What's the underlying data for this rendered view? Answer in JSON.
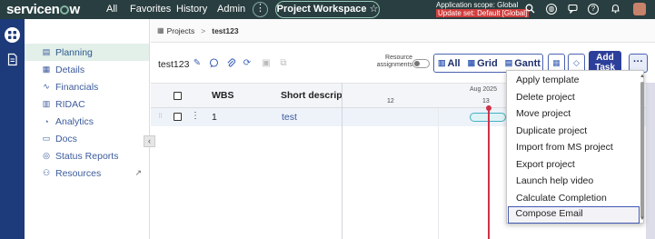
{
  "topnav": {
    "brand": "servicenow",
    "links": [
      "All",
      "Favorites",
      "History",
      "Admin"
    ],
    "more_label": "⋮",
    "workspace_label": "Project Workspace",
    "workspace_star": "☆",
    "scope_line": "Application scope: Global",
    "update_set": "Update set: Default [Global]",
    "icons": [
      "search-icon",
      "globe-icon",
      "chat-icon",
      "help-icon",
      "bell-icon"
    ]
  },
  "breadcrumb": {
    "root": "Projects",
    "separator": ">",
    "current": "test123"
  },
  "sidebar": {
    "items": [
      {
        "label": "Planning",
        "icon": "planning-icon",
        "glyph": "▤",
        "active": true
      },
      {
        "label": "Details",
        "icon": "details-icon",
        "glyph": "▦",
        "active": false
      },
      {
        "label": "Financials",
        "icon": "financials-icon",
        "glyph": "∿",
        "active": false
      },
      {
        "label": "RIDAC",
        "icon": "ridac-icon",
        "glyph": "▥",
        "active": false
      },
      {
        "label": "Analytics",
        "icon": "analytics-icon",
        "glyph": "◔",
        "active": false
      },
      {
        "label": "Docs",
        "icon": "docs-icon",
        "glyph": "▭",
        "active": false
      },
      {
        "label": "Status Reports",
        "icon": "status-reports-icon",
        "glyph": "◎",
        "active": false
      },
      {
        "label": "Resources",
        "icon": "resources-icon",
        "glyph": "⚇",
        "active": false
      }
    ],
    "collapse_glyph": "‹"
  },
  "toolbar": {
    "record_title": "test123",
    "resource_label": "Resource assignments",
    "views": [
      {
        "label": "All",
        "glyph": "▥",
        "selected": true
      },
      {
        "label": "Grid",
        "glyph": "▦",
        "selected": false
      },
      {
        "label": "Gantt",
        "glyph": "▤",
        "selected": false
      }
    ],
    "add_task_label": "Add Task",
    "more_label": "···"
  },
  "grid": {
    "columns": [
      "WBS",
      "Short description"
    ],
    "rows": [
      {
        "wbs": "1",
        "short_description": "test"
      }
    ]
  },
  "gantt": {
    "month": "Aug 2025",
    "days": [
      "12",
      "13"
    ]
  },
  "menu": {
    "items": [
      "Apply template",
      "Delete project",
      "Move project",
      "Duplicate project",
      "Import from MS project",
      "Export project",
      "Launch help video",
      "Calculate Completion Estimates",
      "Compose Email"
    ],
    "focused_index": 8
  },
  "colors": {
    "nav_bg": "#293e40",
    "rail_bg": "#1d3a7a",
    "primary": "#2c3f9b",
    "today_marker": "#d0314a",
    "task_bar": "#44b1c4"
  }
}
